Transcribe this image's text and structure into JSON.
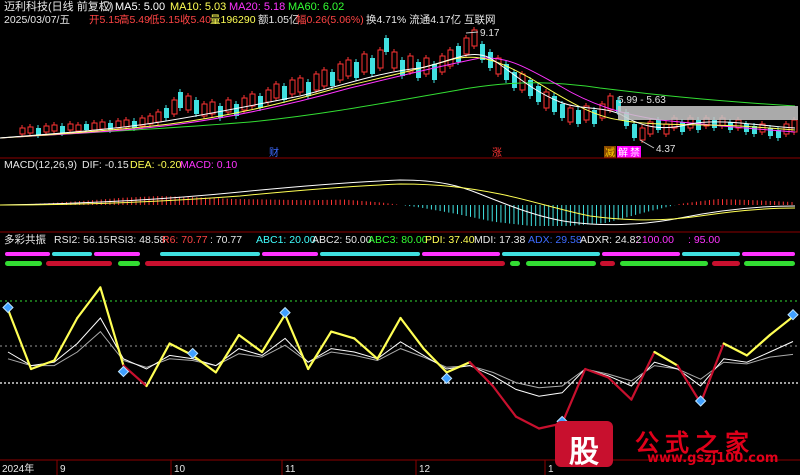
{
  "header": {
    "title": "迈利科技(日线 前复权)",
    "ma5": "MA5: 5.00",
    "ma10": "MA10: 5.03",
    "ma20": "MA20: 5.18",
    "ma60": "MA60: 6.02",
    "date": "2025/03/07/五",
    "open": "开5.15",
    "high": "高5.49",
    "low": "低5.15",
    "close": "收5.40",
    "volume": "量196290",
    "amount": "额1.05亿",
    "change": "幅0.26(5.06%)",
    "turnover": "换4.71% 流通4.17亿 互联网"
  },
  "price_annotations": {
    "peak": "9.17",
    "range": "5.99 - 5.63",
    "low": "4.37",
    "marker_cai": "财",
    "marker_zhang": "涨",
    "marker_jian": "减",
    "marker_jie": "解",
    "marker_jin": "禁"
  },
  "macd_header": {
    "name": "MACD(12,26,9)",
    "dif": "DIF: -0.15",
    "dea": "DEA: -0.20",
    "macd": "MACD: 0.10"
  },
  "rsi_header": {
    "name": "多彩共振",
    "rsi2": "RSI2: 56.15",
    "rsi3": "RSI3: 48.58",
    "r6": "R6: 70.77",
    "r6b": ": 70.77",
    "abc1": "ABC1: 20.00",
    "abc2": "ABC2: 50.00",
    "abc3": "ABC3: 80.00",
    "pdi": "PDI: 37.40",
    "mdi": "MDI: 17.38",
    "adx": "ADX: 29.58",
    "adxr": "ADXR: 24.82",
    "v100": ": 100.00",
    "v95": ": 95.00"
  },
  "axis": {
    "year": "2024年",
    "m9": "9",
    "m10": "10",
    "m11": "11",
    "m12": "12",
    "m1": "1"
  },
  "watermark": {
    "logo": "股",
    "name": "公式之家",
    "url": "www.gszj100.com"
  },
  "colors": {
    "yellow": "#ffff54",
    "white": "#ffffff",
    "red": "#c8102e",
    "magenta": "#ff00ff",
    "green": "#00e000",
    "cyan": "#40ffff",
    "divider": "#8b0000"
  },
  "chart_data": [
    {
      "type": "line",
      "title": "迈利科技(日线 前复权)",
      "series": [
        {
          "name": "MA5",
          "values": [
            3.4,
            3.5,
            3.7,
            4.2,
            4.8,
            5.1,
            5.6,
            6.2,
            6.8,
            7.4,
            7.2,
            7.6,
            8.1,
            8.6,
            8.4,
            7.6,
            6.8,
            6.0,
            5.6,
            5.4,
            5.2,
            5.0
          ]
        },
        {
          "name": "MA10",
          "values": [
            3.5,
            3.5,
            3.6,
            4.0,
            4.5,
            4.9,
            5.3,
            5.9,
            6.5,
            7.0,
            7.1,
            7.4,
            7.8,
            8.2,
            8.3,
            7.9,
            7.2,
            6.5,
            5.9,
            5.5,
            5.2,
            5.03
          ]
        },
        {
          "name": "MA20",
          "values": [
            3.6,
            3.6,
            3.6,
            3.8,
            4.1,
            4.5,
            4.9,
            5.4,
            5.9,
            6.4,
            6.8,
            7.1,
            7.4,
            7.8,
            8.0,
            8.0,
            7.6,
            7.0,
            6.4,
            5.9,
            5.4,
            5.18
          ]
        },
        {
          "name": "MA60",
          "values": [
            3.7,
            3.7,
            3.7,
            3.7,
            3.8,
            3.9,
            4.1,
            4.4,
            4.7,
            5.1,
            5.5,
            5.9,
            6.2,
            6.5,
            6.8,
            7.0,
            7.0,
            6.9,
            6.7,
            6.4,
            6.2,
            6.02
          ]
        }
      ],
      "annotations": [
        "9.17",
        "5.99 - 5.63",
        "4.37"
      ]
    },
    {
      "type": "bar",
      "title": "MACD(12,26,9)",
      "series": [
        {
          "name": "DIF",
          "values": [
            0.0,
            0.05,
            0.15,
            0.3,
            0.45,
            0.55,
            0.6,
            0.65,
            0.7,
            0.75,
            0.72,
            0.6,
            0.4,
            0.1,
            -0.2,
            -0.45,
            -0.6,
            -0.55,
            -0.4,
            -0.25,
            -0.18,
            -0.15
          ]
        },
        {
          "name": "DEA",
          "values": [
            0.0,
            0.02,
            0.08,
            0.18,
            0.3,
            0.42,
            0.5,
            0.56,
            0.62,
            0.66,
            0.68,
            0.64,
            0.55,
            0.38,
            0.15,
            -0.1,
            -0.3,
            -0.42,
            -0.42,
            -0.35,
            -0.26,
            -0.2
          ]
        },
        {
          "name": "MACD",
          "values": [
            0.0,
            0.06,
            0.14,
            0.24,
            0.3,
            0.26,
            0.2,
            0.18,
            0.16,
            0.18,
            0.08,
            -0.08,
            -0.3,
            -0.56,
            -0.7,
            -0.7,
            -0.6,
            -0.26,
            0.04,
            0.2,
            0.16,
            0.1
          ]
        }
      ]
    },
    {
      "type": "line",
      "title": "多彩共振",
      "ylim": [
        0,
        100
      ],
      "reference_lines": [
        20,
        50,
        80
      ],
      "series": [
        {
          "name": "R6",
          "values": [
            75,
            40,
            45,
            70,
            88,
            42,
            30,
            55,
            48,
            38,
            60,
            50,
            72,
            40,
            62,
            58,
            46,
            70,
            52,
            38,
            44,
            30,
            12,
            5,
            8,
            40,
            35,
            22,
            50,
            42,
            20,
            55,
            48,
            60,
            70.77
          ]
        },
        {
          "name": "RSI2",
          "values": [
            50,
            42,
            44,
            55,
            70,
            46,
            40,
            48,
            46,
            42,
            52,
            48,
            58,
            44,
            52,
            50,
            46,
            56,
            48,
            40,
            42,
            36,
            28,
            24,
            26,
            40,
            36,
            30,
            44,
            40,
            30,
            46,
            44,
            50,
            56.15
          ]
        },
        {
          "name": "RSI3",
          "values": [
            46,
            42,
            42,
            50,
            62,
            45,
            41,
            46,
            45,
            42,
            49,
            47,
            54,
            44,
            50,
            48,
            45,
            52,
            47,
            41,
            42,
            38,
            32,
            29,
            30,
            40,
            37,
            33,
            42,
            40,
            34,
            44,
            43,
            47,
            48.58
          ]
        }
      ]
    }
  ]
}
